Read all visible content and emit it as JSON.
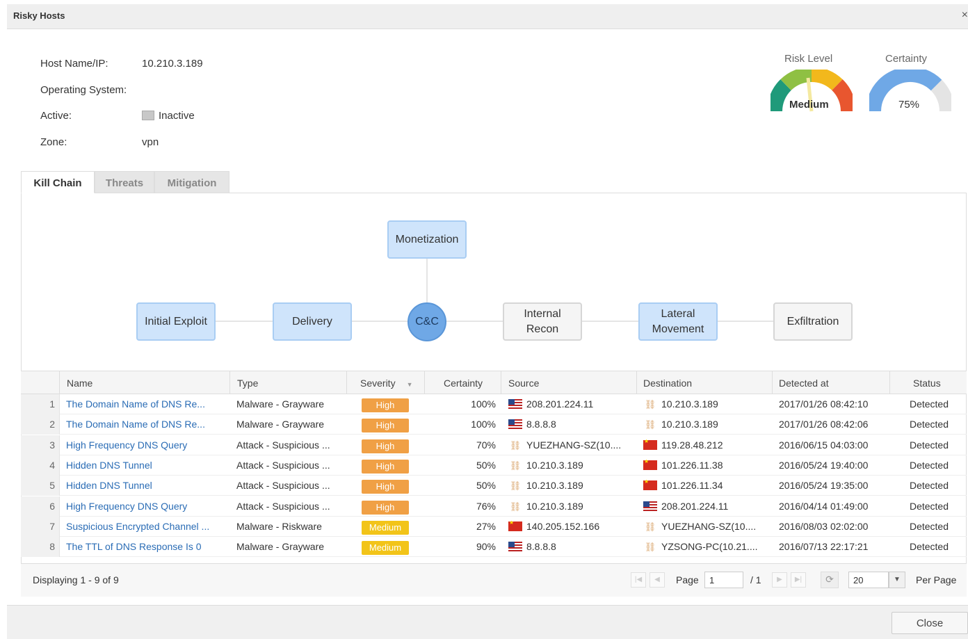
{
  "window": {
    "title": "Risky Hosts",
    "close_icon": "×"
  },
  "host": {
    "labels": {
      "host": "Host Name/IP:",
      "os": "Operating System:",
      "active": "Active:",
      "zone": "Zone:"
    },
    "host_ip": "10.210.3.189",
    "os": "",
    "active": "Inactive",
    "zone": "vpn"
  },
  "gauges": {
    "risk": {
      "label": "Risk Level",
      "value_text": "Medium"
    },
    "certainty": {
      "label": "Certainty",
      "value_text": "75%",
      "fraction": 0.75
    }
  },
  "tabs": [
    "Kill Chain",
    "Threats",
    "Mitigation"
  ],
  "kill_chain": {
    "monetization": "Monetization",
    "stages": [
      "Initial Exploit",
      "Delivery",
      "C&C",
      "Internal Recon",
      "Lateral Movement",
      "Exfiltration"
    ],
    "highlighted": [
      "Monetization",
      "Initial Exploit",
      "Delivery",
      "C&C",
      "Lateral Movement"
    ],
    "colors": {
      "active": "#cfe4fb",
      "inactive": "#f5f5f5",
      "current": "#6fa8e6"
    }
  },
  "grid": {
    "columns": [
      "Name",
      "Type",
      "Severity",
      "Certainty",
      "Source",
      "Destination",
      "Detected at",
      "Status"
    ],
    "rows": [
      {
        "n": "1",
        "name": "The Domain Name of DNS Re...",
        "type": "Malware - Grayware",
        "severity": "High",
        "certainty": "100%",
        "src_icon": "us-flag",
        "source": "208.201.224.11",
        "dst_icon": "host-icon",
        "destination": "10.210.3.189",
        "detected": "2017/01/26 08:42:10",
        "status": "Detected"
      },
      {
        "n": "2",
        "name": "The Domain Name of DNS Re...",
        "type": "Malware - Grayware",
        "severity": "High",
        "certainty": "100%",
        "src_icon": "us-flag",
        "source": "8.8.8.8",
        "dst_icon": "host-icon",
        "destination": "10.210.3.189",
        "detected": "2017/01/26 08:42:06",
        "status": "Detected"
      },
      {
        "n": "3",
        "name": "High Frequency DNS Query",
        "type": "Attack - Suspicious ...",
        "severity": "High",
        "certainty": "70%",
        "src_icon": "host-icon",
        "source": "YUEZHANG-SZ(10....",
        "dst_icon": "cn-flag",
        "destination": "119.28.48.212",
        "detected": "2016/06/15 04:03:00",
        "status": "Detected"
      },
      {
        "n": "4",
        "name": "Hidden DNS Tunnel",
        "type": "Attack - Suspicious ...",
        "severity": "High",
        "certainty": "50%",
        "src_icon": "host-icon",
        "source": "10.210.3.189",
        "dst_icon": "cn-flag",
        "destination": "101.226.11.38",
        "detected": "2016/05/24 19:40:00",
        "status": "Detected"
      },
      {
        "n": "5",
        "name": "Hidden DNS Tunnel",
        "type": "Attack - Suspicious ...",
        "severity": "High",
        "certainty": "50%",
        "src_icon": "host-icon",
        "source": "10.210.3.189",
        "dst_icon": "cn-flag",
        "destination": "101.226.11.34",
        "detected": "2016/05/24 19:35:00",
        "status": "Detected"
      },
      {
        "n": "6",
        "name": "High Frequency DNS Query",
        "type": "Attack - Suspicious ...",
        "severity": "High",
        "certainty": "76%",
        "src_icon": "host-icon",
        "source": "10.210.3.189",
        "dst_icon": "us-flag",
        "destination": "208.201.224.11",
        "detected": "2016/04/14 01:49:00",
        "status": "Detected"
      },
      {
        "n": "7",
        "name": "Suspicious Encrypted Channel ...",
        "type": "Malware - Riskware",
        "severity": "Medium",
        "certainty": "27%",
        "src_icon": "cn-flag",
        "source": "140.205.152.166",
        "dst_icon": "host-icon",
        "destination": "YUEZHANG-SZ(10....",
        "detected": "2016/08/03 02:02:00",
        "status": "Detected"
      },
      {
        "n": "8",
        "name": "The TTL of DNS Response Is 0",
        "type": "Malware - Grayware",
        "severity": "Medium",
        "certainty": "90%",
        "src_icon": "us-flag",
        "source": "8.8.8.8",
        "dst_icon": "host-icon",
        "destination": "YZSONG-PC(10.21....",
        "detected": "2016/07/13 22:17:21",
        "status": "Detected"
      }
    ],
    "severity_colors": {
      "High": "#f0a045",
      "Medium": "#f2c419"
    }
  },
  "footer": {
    "displaying": "Displaying 1 - 9 of 9",
    "page_label": "Page",
    "page_value": "1",
    "of_pages": "/ 1",
    "per_page_value": "20",
    "per_page_label": "Per Page"
  },
  "buttons": {
    "close": "Close"
  }
}
